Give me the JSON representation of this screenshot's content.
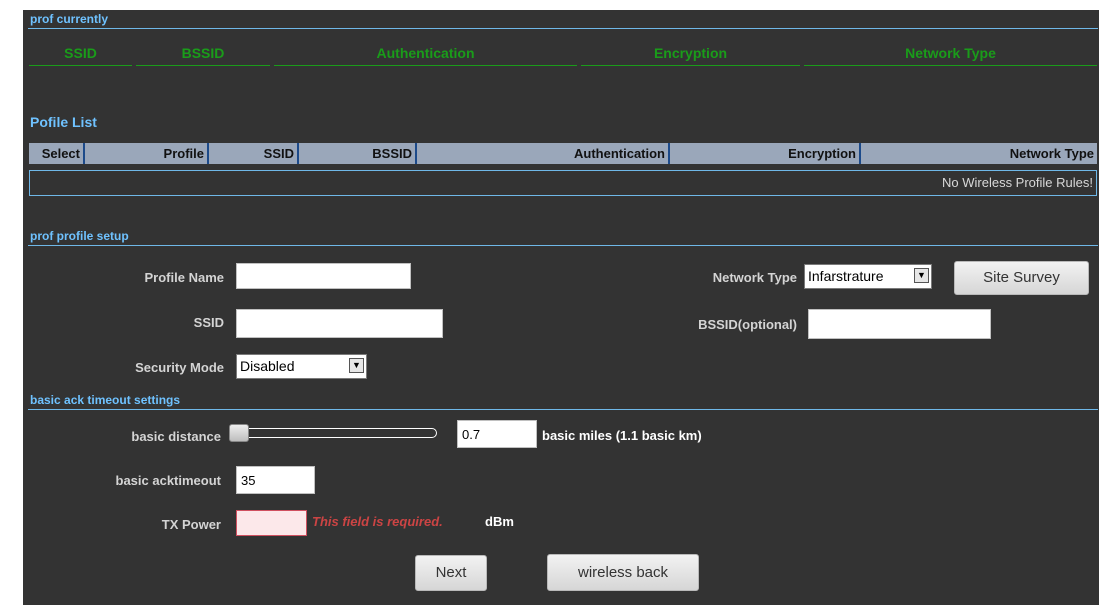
{
  "current": {
    "title": "prof currently",
    "columns": [
      "SSID",
      "BSSID",
      "Authentication",
      "Encryption",
      "Network Type"
    ]
  },
  "profile_list": {
    "title": "Pofile List",
    "columns": [
      "Select",
      "Profile",
      "SSID",
      "BSSID",
      "Authentication",
      "Encryption",
      "Network Type"
    ],
    "empty_text": "No Wireless Profile Rules!"
  },
  "setup": {
    "title": "prof profile setup",
    "profile_name_label": "Profile Name",
    "profile_name_value": "",
    "network_type_label": "Network Type",
    "network_type_value": "Infarstrature",
    "site_survey_label": "Site Survey",
    "ssid_label": "SSID",
    "ssid_value": "",
    "bssid_label": "BSSID(optional)",
    "bssid_value": "",
    "security_mode_label": "Security Mode",
    "security_mode_value": "Disabled"
  },
  "ack": {
    "title": "basic ack timeout settings",
    "distance_label": "basic distance",
    "distance_value": "0.7",
    "distance_slider_fraction": 0,
    "distance_unit": "basic miles (1.1 basic km)",
    "acktimeout_label": "basic acktimeout",
    "acktimeout_value": "35",
    "txpower_label": "TX Power",
    "txpower_value": "",
    "txpower_error": "This field is required.",
    "txpower_unit": "dBm"
  },
  "buttons": {
    "next": "Next",
    "back": "wireless back"
  }
}
